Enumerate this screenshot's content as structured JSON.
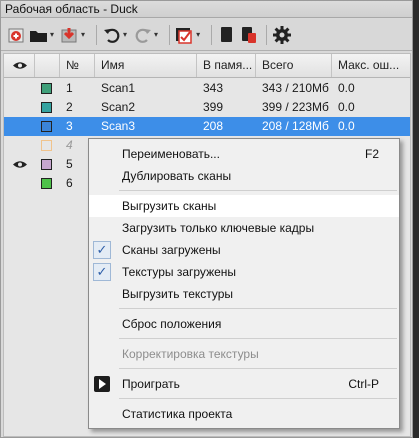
{
  "window": {
    "title": "Рабочая область - Duck"
  },
  "table": {
    "columns": [
      "№",
      "Имя",
      "В памя...",
      "Всего",
      "Макс. ош..."
    ],
    "rows": [
      {
        "num": "1",
        "name": "Scan1",
        "in_memory": "343",
        "total": "343 / 210Мб",
        "max_err": "0.0",
        "visible": false,
        "color": "#3fa07a",
        "selected": false,
        "dimmed": false
      },
      {
        "num": "2",
        "name": "Scan2",
        "in_memory": "399",
        "total": "399 / 223Мб",
        "max_err": "0.0",
        "visible": false,
        "color": "#35a3a0",
        "selected": false,
        "dimmed": false
      },
      {
        "num": "3",
        "name": "Scan3",
        "in_memory": "208",
        "total": "208 / 128Мб",
        "max_err": "0.0",
        "visible": false,
        "color": "#3b84d8",
        "selected": true,
        "dimmed": false
      },
      {
        "num": "4",
        "name": "",
        "in_memory": "",
        "total": "",
        "max_err": "",
        "visible": false,
        "color": "#f0c38c",
        "selected": false,
        "dimmed": true
      },
      {
        "num": "5",
        "name": "",
        "in_memory": "",
        "total": "",
        "max_err": "",
        "visible": true,
        "color": "#c7a6cf",
        "selected": false,
        "dimmed": false
      },
      {
        "num": "6",
        "name": "",
        "in_memory": "",
        "total": "",
        "max_err": "",
        "visible": false,
        "color": "#4ec24a",
        "selected": false,
        "dimmed": false
      }
    ]
  },
  "context_menu": {
    "rename": {
      "label": "Переименовать...",
      "shortcut": "F2"
    },
    "duplicate": {
      "label": "Дублировать сканы"
    },
    "unload": {
      "label": "Выгрузить сканы"
    },
    "load_keyframes": {
      "label": "Загрузить только ключевые кадры"
    },
    "scans_loaded": {
      "label": "Сканы загружены",
      "checked": true
    },
    "textures_loaded": {
      "label": "Текстуры загружены",
      "checked": true
    },
    "unload_textures": {
      "label": "Выгрузить текстуры"
    },
    "reset_position": {
      "label": "Сброс положения"
    },
    "texture_correction": {
      "label": "Корректировка текстуры",
      "disabled": true
    },
    "play": {
      "label": "Проиграть",
      "shortcut": "Ctrl-P"
    },
    "stats": {
      "label": "Статистика проекта"
    }
  },
  "colors": {
    "selection": "#3d8ee8",
    "accent_red": "#d9342b"
  }
}
